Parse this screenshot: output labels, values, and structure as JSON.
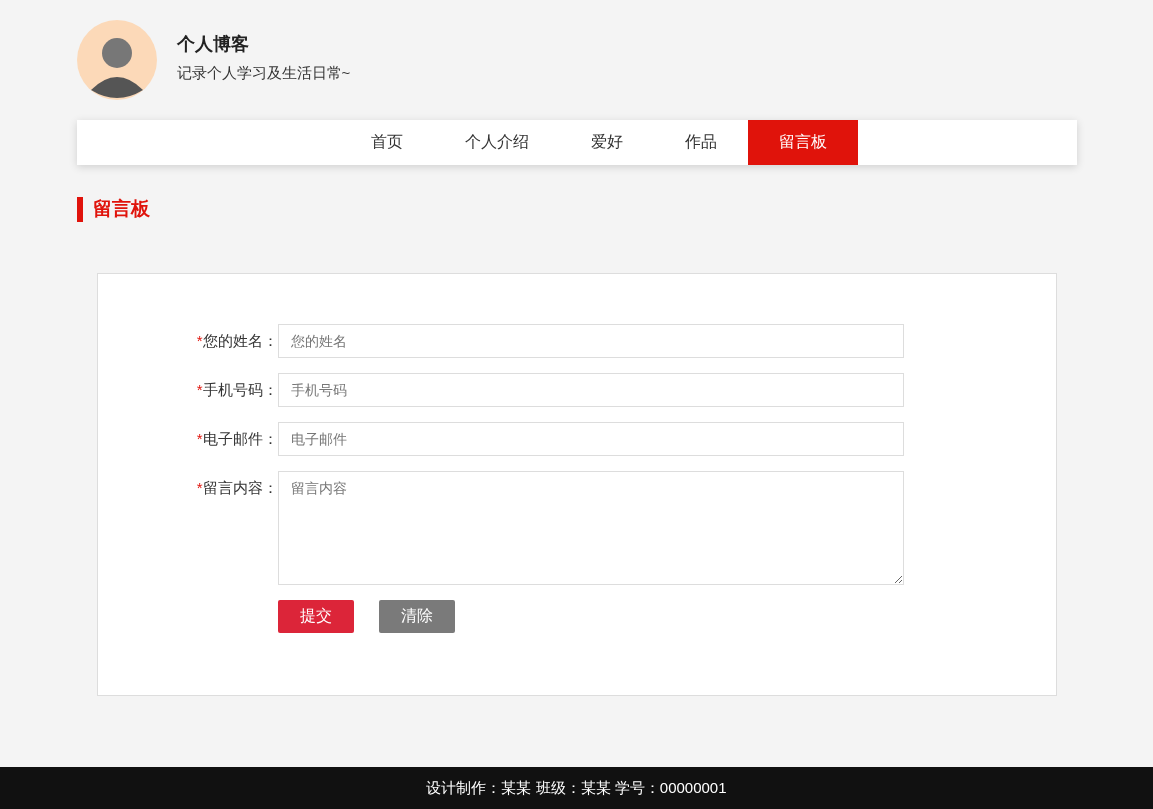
{
  "header": {
    "title": "个人博客",
    "subtitle": "记录个人学习及生活日常~"
  },
  "nav": [
    {
      "label": "首页",
      "selected": false
    },
    {
      "label": "个人介绍",
      "selected": false
    },
    {
      "label": "爱好",
      "selected": false
    },
    {
      "label": "作品",
      "selected": false
    },
    {
      "label": "留言板",
      "selected": true
    }
  ],
  "section_title": "留言板",
  "form": {
    "fields": [
      {
        "marker": "*",
        "label": "您的姓名：",
        "placeholder": "您的姓名",
        "kind": "input"
      },
      {
        "marker": "*",
        "label": "手机号码：",
        "placeholder": "手机号码",
        "kind": "input"
      },
      {
        "marker": "*",
        "label": "电子邮件：",
        "placeholder": "电子邮件",
        "kind": "input"
      },
      {
        "marker": "*",
        "label": "留言内容：",
        "placeholder": "留言内容",
        "kind": "textarea"
      }
    ],
    "buttons": [
      {
        "label": "提交",
        "kind": "primary"
      },
      {
        "label": "清除",
        "kind": "secondary"
      }
    ]
  },
  "footer": "设计制作：某某 班级：某某 学号：00000001"
}
